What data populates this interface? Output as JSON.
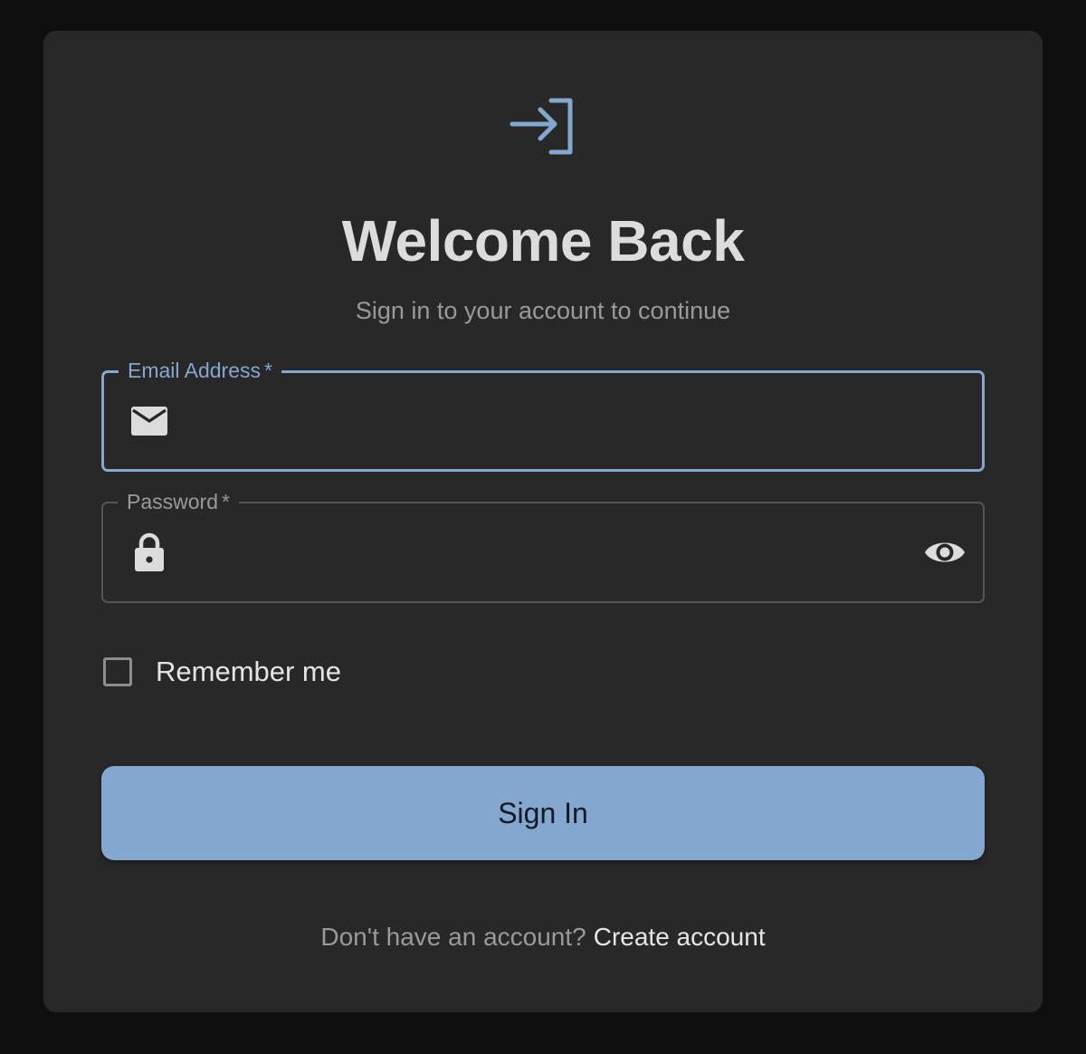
{
  "header": {
    "icon": "login-icon",
    "title": "Welcome Back",
    "subtitle": "Sign in to your account to continue"
  },
  "form": {
    "email": {
      "label": "Email Address",
      "required_mark": "*",
      "value": "",
      "icon": "mail-icon",
      "state": "focused"
    },
    "password": {
      "label": "Password",
      "required_mark": "*",
      "value": "",
      "icon": "lock-icon",
      "toggle_icon": "eye-icon"
    },
    "remember_me": {
      "label": "Remember me",
      "checked": false
    },
    "submit_label": "Sign In"
  },
  "footer": {
    "prompt": "Don't have an account?",
    "link_label": "Create account"
  },
  "colors": {
    "page_background": "#0f0f0f",
    "card_background": "#282828",
    "accent": "#83a7ce",
    "title_text": "#dcdcdc",
    "muted_text": "#9a9a9a"
  }
}
